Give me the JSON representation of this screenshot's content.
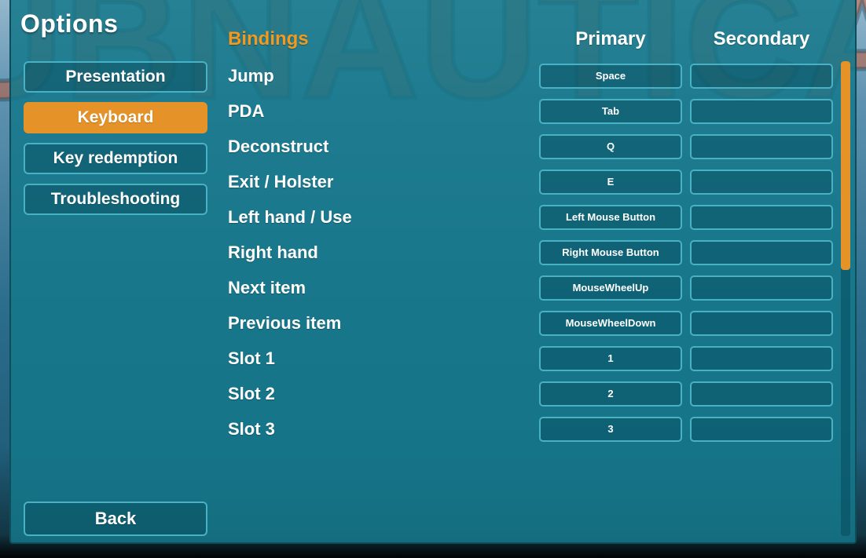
{
  "title": "Options",
  "sidebar": {
    "tabs": [
      {
        "label": "Presentation",
        "active": false
      },
      {
        "label": "Keyboard",
        "active": true
      },
      {
        "label": "Key redemption",
        "active": false
      },
      {
        "label": "Troubleshooting",
        "active": false
      }
    ]
  },
  "back_label": "Back",
  "bindings": {
    "heading": "Bindings",
    "columns": {
      "primary": "Primary",
      "secondary": "Secondary"
    },
    "rows": [
      {
        "label": "Jump",
        "primary": "Space",
        "secondary": ""
      },
      {
        "label": "PDA",
        "primary": "Tab",
        "secondary": ""
      },
      {
        "label": "Deconstruct",
        "primary": "Q",
        "secondary": ""
      },
      {
        "label": "Exit / Holster",
        "primary": "E",
        "secondary": ""
      },
      {
        "label": "Left hand / Use",
        "primary": "Left Mouse Button",
        "secondary": ""
      },
      {
        "label": "Right hand",
        "primary": "Right Mouse Button",
        "secondary": ""
      },
      {
        "label": "Next item",
        "primary": "MouseWheelUp",
        "secondary": ""
      },
      {
        "label": "Previous item",
        "primary": "MouseWheelDown",
        "secondary": ""
      },
      {
        "label": "Slot 1",
        "primary": "1",
        "secondary": ""
      },
      {
        "label": "Slot 2",
        "primary": "2",
        "secondary": ""
      },
      {
        "label": "Slot 3",
        "primary": "3",
        "secondary": ""
      }
    ]
  },
  "bg_logo_text": "UBNAUTICA",
  "colors": {
    "accent": "#e59328",
    "outline": "#48b1c4"
  }
}
